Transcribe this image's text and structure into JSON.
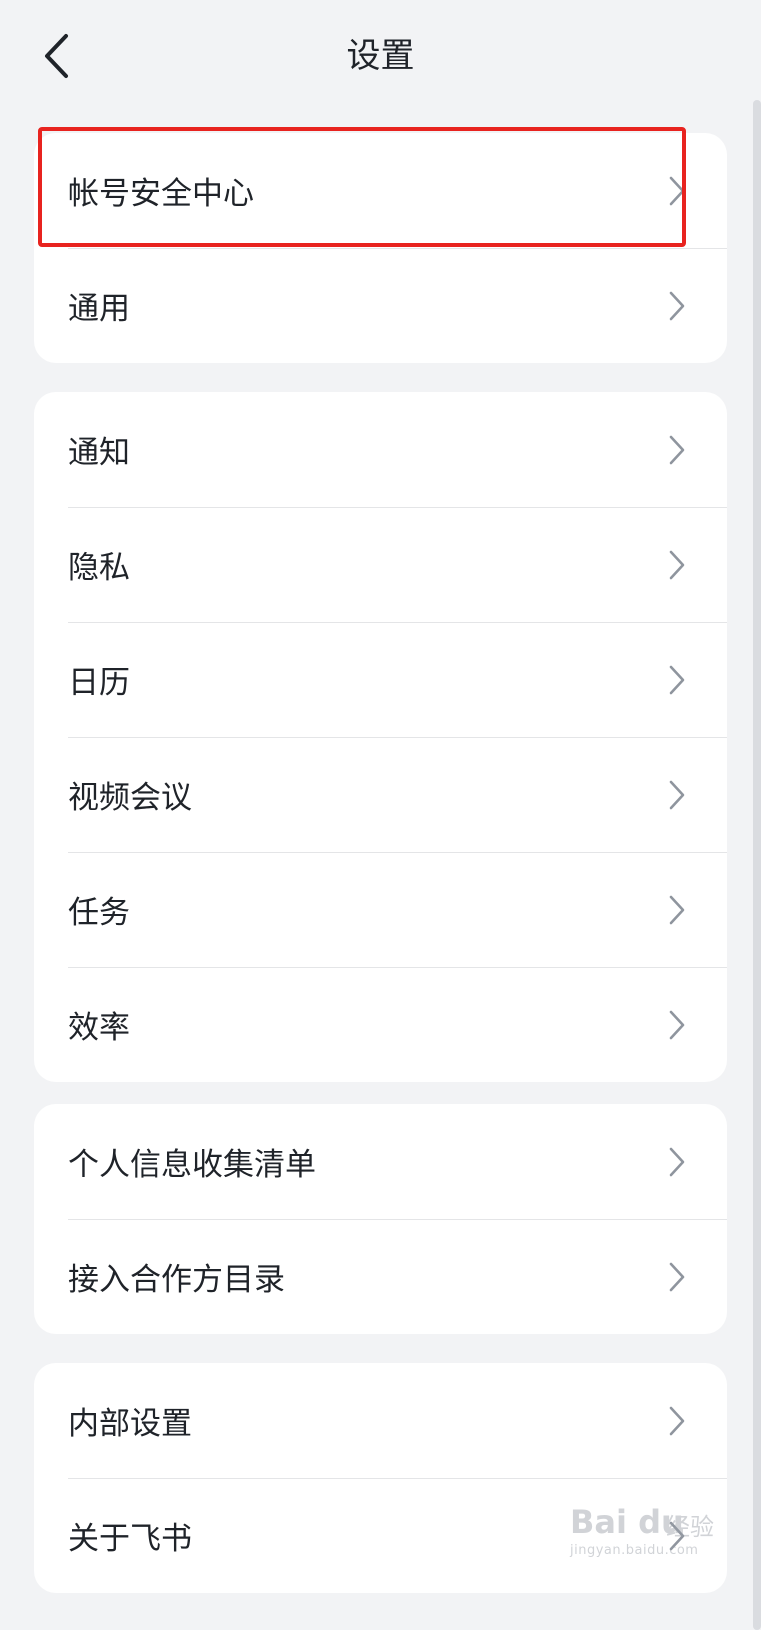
{
  "header": {
    "title": "设置",
    "back_icon": "chevron-left-icon"
  },
  "groups": [
    {
      "items": [
        {
          "label": "帐号安全中心"
        },
        {
          "label": "通用"
        }
      ]
    },
    {
      "items": [
        {
          "label": "通知"
        },
        {
          "label": "隐私"
        },
        {
          "label": "日历"
        },
        {
          "label": "视频会议"
        },
        {
          "label": "任务"
        },
        {
          "label": "效率"
        }
      ]
    },
    {
      "items": [
        {
          "label": "个人信息收集清单"
        },
        {
          "label": "接入合作方目录"
        }
      ]
    },
    {
      "items": [
        {
          "label": "内部设置"
        },
        {
          "label": "关于飞书"
        }
      ]
    }
  ],
  "annotation": {
    "highlight_color": "#e8231f"
  },
  "watermark": {
    "logo": "Bai du",
    "brand": "经验",
    "url": "jingyan.baidu.com"
  },
  "colors": {
    "background": "#f2f3f5",
    "card": "#ffffff",
    "text": "#1f2329",
    "chevron": "#8f959e"
  }
}
